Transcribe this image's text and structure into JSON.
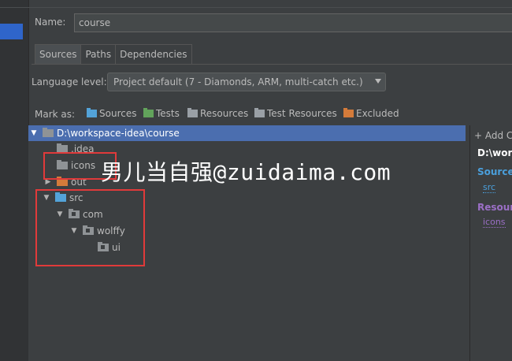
{
  "dialog": {
    "name_label": "Name:",
    "name_value": "course"
  },
  "tabs": [
    "Sources",
    "Paths",
    "Dependencies"
  ],
  "language": {
    "label": "Language level:",
    "value": "Project default (7 - Diamonds, ARM, multi-catch etc.)"
  },
  "mark_as": {
    "label": "Mark as:",
    "items": [
      {
        "label": "Sources",
        "color": "#53a3d9"
      },
      {
        "label": "Tests",
        "color": "#62a35b"
      },
      {
        "label": "Resources",
        "color": "#9aa0a6"
      },
      {
        "label": "Test Resources",
        "color": "#9aa0a6"
      },
      {
        "label": "Excluded",
        "color": "#d47b3a"
      }
    ]
  },
  "tree": {
    "root": "D:\\workspace-idea\\course",
    "items": [
      ".idea",
      "icons",
      "out",
      "src",
      "com",
      "wolffy",
      "ui"
    ]
  },
  "right_panel": {
    "add_label": "+ Add C",
    "path": "D:\\work",
    "sources_heading": "Source",
    "sources_item": "src",
    "resources_heading": "Resourc",
    "resources_item": "icons"
  },
  "watermark": "男儿当自强@zuidaima.com"
}
